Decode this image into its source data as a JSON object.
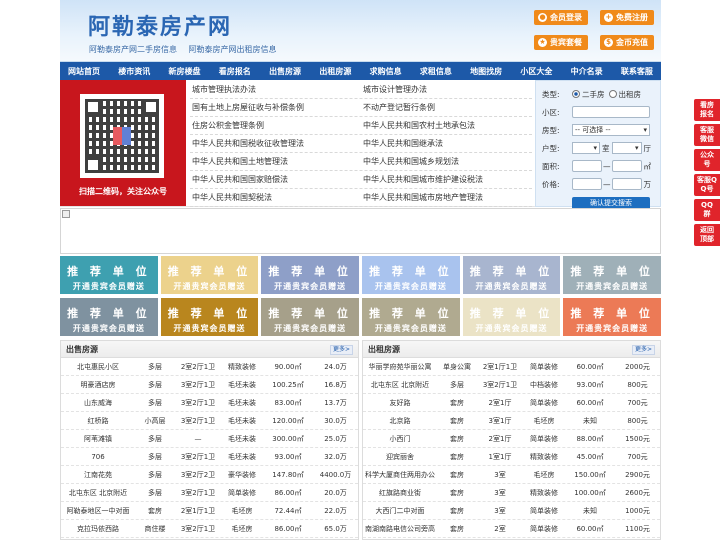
{
  "header": {
    "logo": "阿勒泰房产网",
    "subtitles": [
      "阿勒泰房产网二手房信息",
      "阿勒泰房产网出租房信息"
    ],
    "buttons": [
      "会员登录",
      "免费注册",
      "贵宾套餐",
      "金币充值"
    ]
  },
  "nav": [
    "网站首页",
    "楼市资讯",
    "新房楼盘",
    "看房报名",
    "出售房源",
    "出租房源",
    "求购信息",
    "求租信息",
    "地图找房",
    "小区大全",
    "中介名录",
    "联系客服"
  ],
  "qr": {
    "caption": "扫描二维码，关注公众号"
  },
  "links": [
    [
      "城市管理执法办法",
      "城市设计管理办法"
    ],
    [
      "国有土地上房屋征收与补偿条例",
      "不动产登记暂行条例"
    ],
    [
      "住房公积金管理条例",
      "中华人民共和国农村土地承包法"
    ],
    [
      "中华人民共和国税收征收管理法",
      "中华人民共和国继承法"
    ],
    [
      "中华人民共和国土地管理法",
      "中华人民共和国城乡规划法"
    ],
    [
      "中华人民共和国国家赔偿法",
      "中华人民共和国城市维护建设税法"
    ],
    [
      "中华人民共和国契税法",
      "中华人民共和国城市房地产管理法"
    ]
  ],
  "search": {
    "type_label": "类型:",
    "type_options": [
      "二手房",
      "出租房"
    ],
    "community_label": "小区:",
    "housing_label": "房型:",
    "housing_value": "-- 可选择 --",
    "layout_label": "户型:",
    "room_unit": "室",
    "hall_unit": "厅",
    "area_label": "面积:",
    "area_sep": "—",
    "area_unit": "㎡",
    "price_label": "价格:",
    "price_sep": "—",
    "price_unit": "万",
    "submit": "确认提交搜索"
  },
  "tiles": {
    "line1": "推 荐 单 位",
    "line2": "开通贵宾会员赠送",
    "colors": [
      "#3ea0b0",
      "#ecd28c",
      "#8e9fc8",
      "#a9c3ee",
      "#a8b5cf",
      "#9fb0b8",
      "#7f92a0",
      "#b9861e",
      "#a6a08a",
      "#b0aa90",
      "#ebe3c6",
      "#ec7a56"
    ]
  },
  "sale": {
    "title": "出售房源",
    "more": "更多>",
    "rows": [
      [
        "北屯惠民小区",
        "多层",
        "2室2厅1卫",
        "精致装修",
        "90.00㎡",
        "24.0万"
      ],
      [
        "明豪酒店房",
        "多层",
        "3室2厅1卫",
        "毛坯未装",
        "100.25㎡",
        "16.8万"
      ],
      [
        "山东威海",
        "多层",
        "3室2厅1卫",
        "毛坯未装",
        "83.00㎡",
        "13.7万"
      ],
      [
        "红桥路",
        "小高层",
        "3室2厅1卫",
        "毛坯未装",
        "120.00㎡",
        "30.0万"
      ],
      [
        "阿苇滩镇",
        "多层",
        "—",
        "毛坯未装",
        "300.00㎡",
        "25.0万"
      ],
      [
        "706",
        "多层",
        "3室2厅1卫",
        "毛坯未装",
        "93.00㎡",
        "32.0万"
      ],
      [
        "江南花苑",
        "多层",
        "3室2厅2卫",
        "豪华装修",
        "147.80㎡",
        "4400.0万"
      ],
      [
        "北屯东区 北京附近",
        "多层",
        "3室2厅1卫",
        "简单装修",
        "86.00㎡",
        "20.0万"
      ],
      [
        "阿勒泰地区一中对面",
        "套房",
        "2室1厅1卫",
        "毛坯房",
        "72.44㎡",
        "22.0万"
      ],
      [
        "克拉玛依西路",
        "商住楼",
        "3室2厅1卫",
        "毛坯房",
        "86.00㎡",
        "65.0万"
      ]
    ]
  },
  "rent": {
    "title": "出租房源",
    "more": "更多>",
    "rows": [
      [
        "华丽学府苑华丽公寓",
        "单身公寓",
        "2室1厅1卫",
        "简单装修",
        "60.00㎡",
        "2000元"
      ],
      [
        "北屯东区 北京附近",
        "多层",
        "3室2厅1卫",
        "中档装修",
        "93.00㎡",
        "800元"
      ],
      [
        "友好路",
        "套房",
        "2室1厅",
        "简单装修",
        "60.00㎡",
        "700元"
      ],
      [
        "北京路",
        "套房",
        "3室1厅",
        "毛坯房",
        "未知",
        "800元"
      ],
      [
        "小西门",
        "套房",
        "2室1厅",
        "简单装修",
        "88.00㎡",
        "1500元"
      ],
      [
        "迎宾丽舍",
        "套房",
        "1室1厅",
        "精致装修",
        "45.00㎡",
        "700元"
      ],
      [
        "科学大厦商住两用办公",
        "套房",
        "3室",
        "毛坯房",
        "150.00㎡",
        "2900元"
      ],
      [
        "红旗路商业街",
        "套房",
        "3室",
        "精致装修",
        "100.00㎡",
        "2600元"
      ],
      [
        "大西门二中对面",
        "套房",
        "3室",
        "简单装修",
        "未知",
        "1000元"
      ],
      [
        "南湖南路电信公司旁高",
        "套房",
        "2室",
        "简单装修",
        "60.00㎡",
        "1100元"
      ]
    ]
  },
  "side": [
    "看房报名",
    "客服微信",
    "公众号",
    "客服QQ号",
    "QQ群",
    "返回顶部"
  ]
}
